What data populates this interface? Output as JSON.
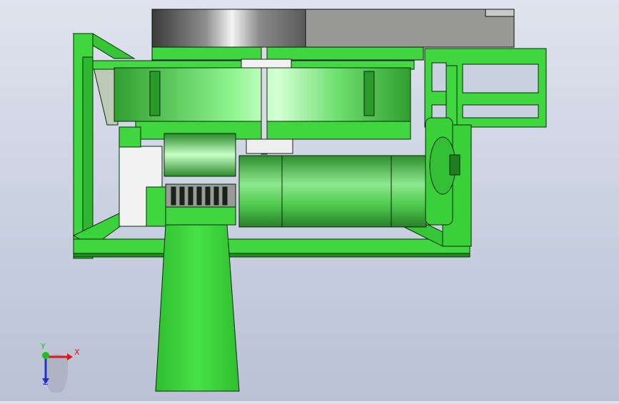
{
  "viewport": {
    "colors": {
      "background_top": "#dfe3ee",
      "background_bottom": "#b9c1d4",
      "frame_green": "#3fd63f",
      "frame_green_dark": "#1f8f1f",
      "frame_outline": "#0a2a0a",
      "metal_grey": "#9a9a98",
      "metal_dark": "#3a3a3a"
    }
  },
  "triad": {
    "x_label": "X",
    "y_label": "Y",
    "z_label": "Z",
    "x_color": "#e01818",
    "y_color": "#20c020",
    "z_color": "#2030d0"
  }
}
